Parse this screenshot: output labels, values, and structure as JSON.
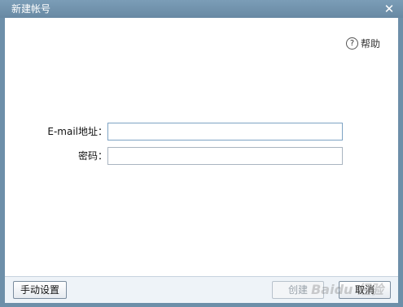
{
  "window": {
    "title": "新建帐号",
    "close_glyph": "✕"
  },
  "help": {
    "icon_glyph": "?",
    "label": "帮助"
  },
  "form": {
    "email_label": "E-mail地址：",
    "email_value": "",
    "password_label": "密码：",
    "password_value": ""
  },
  "footer": {
    "manual_settings_label": "手动设置",
    "create_label": "创建",
    "cancel_label": "取消"
  },
  "watermark": "Baidu 经验",
  "colors": {
    "titlebar": "#6d8fa9",
    "footer": "#eef3f8"
  }
}
